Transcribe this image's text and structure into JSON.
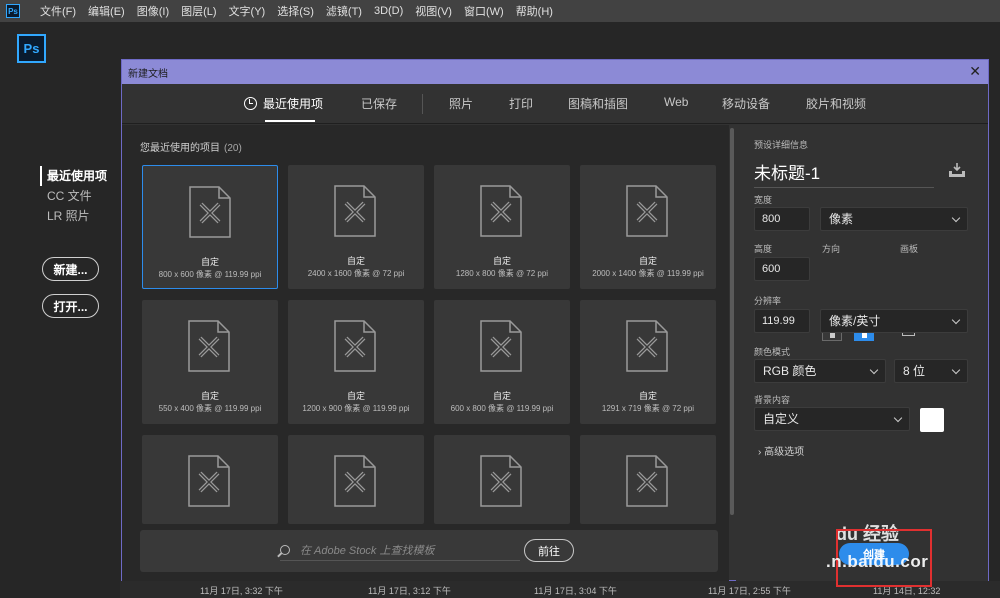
{
  "menubar": {
    "app_icon": "Ps",
    "items": [
      "文件(F)",
      "编辑(E)",
      "图像(I)",
      "图层(L)",
      "文字(Y)",
      "选择(S)",
      "滤镜(T)",
      "3D(D)",
      "视图(V)",
      "窗口(W)",
      "帮助(H)"
    ]
  },
  "home": {
    "logo": "Ps",
    "nav": [
      "最近使用项",
      "CC 文件",
      "LR 照片"
    ],
    "new_button": "新建...",
    "open_button": "打开..."
  },
  "recent_dates": [
    "11月 17日, 3:32 下午",
    "11月 17日, 3:12 下午",
    "11月 17日, 3:04 下午",
    "11月 17日, 2:55 下午",
    "11月 14日, 12:32"
  ],
  "dialog": {
    "title": "新建文档",
    "close": "✕",
    "tabs": [
      "最近使用项",
      "已保存",
      "照片",
      "打印",
      "图稿和插图",
      "Web",
      "移动设备",
      "胶片和视频"
    ],
    "recent_header": "您最近使用的项目",
    "recent_count": "(20)",
    "cards": [
      {
        "name": "自定",
        "info": "800 x 600 像素 @ 119.99 ppi"
      },
      {
        "name": "自定",
        "info": "2400 x 1600 像素 @ 72 ppi"
      },
      {
        "name": "自定",
        "info": "1280 x 800 像素 @ 72 ppi"
      },
      {
        "name": "自定",
        "info": "2000 x 1400 像素 @ 119.99 ppi"
      },
      {
        "name": "自定",
        "info": "550 x 400 像素 @ 119.99 ppi"
      },
      {
        "name": "自定",
        "info": "1200 x 900 像素 @ 119.99 ppi"
      },
      {
        "name": "自定",
        "info": "600 x 800 像素 @ 119.99 ppi"
      },
      {
        "name": "自定",
        "info": "1291 x 719 像素 @ 72 ppi"
      },
      {
        "name": "",
        "info": ""
      },
      {
        "name": "",
        "info": ""
      },
      {
        "name": "",
        "info": ""
      },
      {
        "name": "",
        "info": ""
      }
    ],
    "stock_placeholder": "在 Adobe Stock 上查找模板",
    "stock_button": "前往",
    "preset": {
      "section_label": "预设详细信息",
      "doc_name": "未标题-1",
      "width_label": "宽度",
      "width_value": "800",
      "width_unit": "像素",
      "height_label": "高度",
      "height_value": "600",
      "orientation_label": "方向",
      "artboard_label": "画板",
      "resolution_label": "分辨率",
      "resolution_value": "119.99",
      "resolution_unit": "像素/英寸",
      "color_mode_label": "颜色模式",
      "color_mode_value": "RGB 颜色",
      "bit_depth_value": "8 位",
      "background_label": "背景内容",
      "background_value": "自定义",
      "background_color": "#ffffff",
      "advanced": "高级选项",
      "create_button": "创建"
    }
  },
  "watermark": {
    "top": "du 经验",
    "bottom": ".n.baidu.cor"
  },
  "colors": {
    "accent": "#2d8ceb",
    "title_bar": "#8c8ad6",
    "highlight_box": "#e03030"
  }
}
